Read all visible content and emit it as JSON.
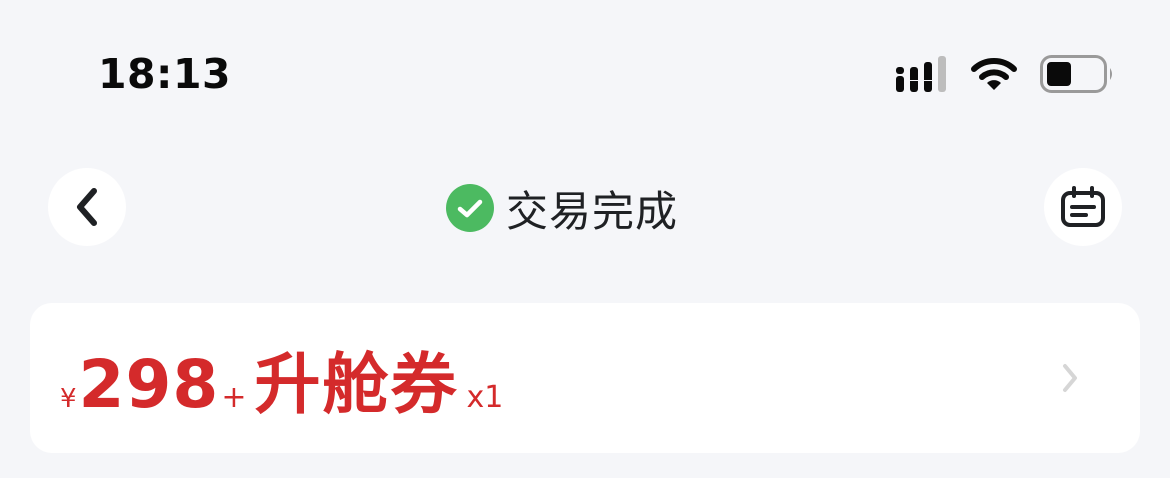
{
  "status_bar": {
    "time": "18:13",
    "icons": [
      "signal-icon",
      "wifi-icon",
      "battery-icon"
    ]
  },
  "nav": {
    "back_icon": "chevron-left-icon",
    "title": "交易完成",
    "status_icon": "check-circle-icon",
    "right_icon": "calendar-icon"
  },
  "ticket": {
    "currency": "¥",
    "amount": "298",
    "plus": "+",
    "name": "升舱券",
    "quantity": "x1",
    "arrow_icon": "chevron-right-icon"
  },
  "colors": {
    "background": "#f5f6f9",
    "card": "#ffffff",
    "price_red": "#d42a2b",
    "success_green": "#4cba61",
    "text_dark": "#1f2124"
  }
}
